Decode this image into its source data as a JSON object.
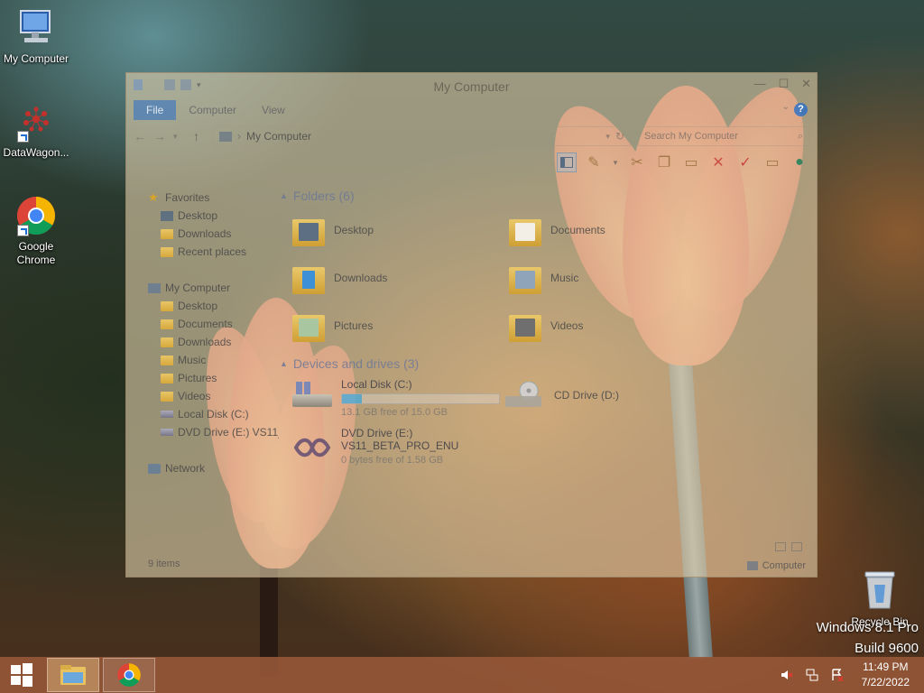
{
  "desktop": {
    "icons": [
      {
        "label": "My Computer"
      },
      {
        "label": "DataWagon..."
      },
      {
        "label": "Google Chrome"
      },
      {
        "label": "Recycle Bin"
      }
    ],
    "watermark": {
      "line1": "Windows 8.1 Pro",
      "line2": "Build 9600"
    }
  },
  "explorer": {
    "title": "My Computer",
    "tabs": [
      {
        "label": "File"
      },
      {
        "label": "Computer"
      },
      {
        "label": "View"
      }
    ],
    "help": "?",
    "address": "My Computer",
    "search_placeholder": "Search My Computer",
    "nav": {
      "favorites": "Favorites",
      "favorites_items": [
        {
          "label": "Desktop"
        },
        {
          "label": "Downloads"
        },
        {
          "label": "Recent places"
        }
      ],
      "computer": "My Computer",
      "computer_items": [
        {
          "label": "Desktop"
        },
        {
          "label": "Documents"
        },
        {
          "label": "Downloads"
        },
        {
          "label": "Music"
        },
        {
          "label": "Pictures"
        },
        {
          "label": "Videos"
        },
        {
          "label": "Local Disk (C:)"
        },
        {
          "label": "DVD Drive (E:) VS11_"
        }
      ],
      "network": "Network"
    },
    "folders_header": "Folders (6)",
    "folders": [
      {
        "label": "Desktop"
      },
      {
        "label": "Documents"
      },
      {
        "label": "Downloads"
      },
      {
        "label": "Music"
      },
      {
        "label": "Pictures"
      },
      {
        "label": "Videos"
      }
    ],
    "drives_header": "Devices and drives (3)",
    "drives": {
      "c": {
        "name": "Local Disk (C:)",
        "free": "13.1 GB free of 15.0 GB",
        "used_fraction": 0.127
      },
      "d": {
        "name": "CD Drive (D:)"
      },
      "e": {
        "name": "DVD Drive (E:)",
        "name2": "VS11_BETA_PRO_ENU",
        "free": "0 bytes free of 1.58 GB"
      }
    },
    "status": {
      "items": "9 items",
      "location": "Computer"
    }
  },
  "taskbar": {
    "time": "11:49 PM",
    "date": "7/22/2022"
  }
}
